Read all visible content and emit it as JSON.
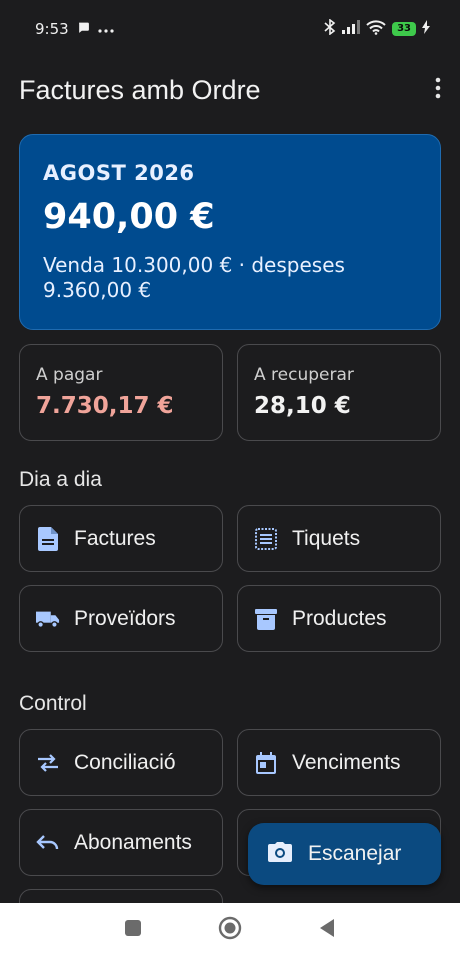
{
  "status": {
    "time": "9:53",
    "battery": "33"
  },
  "app": {
    "title": "Factures amb Ordre"
  },
  "summary": {
    "month": "AGOST 2026",
    "amount": "940,00 €",
    "detail": "Venda 10.300,00 € · despeses 9.360,00 €"
  },
  "stats": [
    {
      "label": "A pagar",
      "value": "7.730,17 €",
      "color": "#f0a49a"
    },
    {
      "label": "A recuperar",
      "value": "28,10 €",
      "color": "#f2f2f2"
    }
  ],
  "sections": {
    "daily": "Dia a dia",
    "control": "Control"
  },
  "tiles": {
    "factures": "Factures",
    "tiquets": "Tiquets",
    "proveidors": "Proveïdors",
    "productes": "Productes",
    "conciliacio": "Conciliació",
    "venciments": "Venciments",
    "abonaments": "Abonaments"
  },
  "fab": {
    "label": "Escanejar"
  },
  "colors": {
    "accent": "#a8c8ff",
    "card": "#004b8f",
    "background": "#1c1c1e"
  }
}
